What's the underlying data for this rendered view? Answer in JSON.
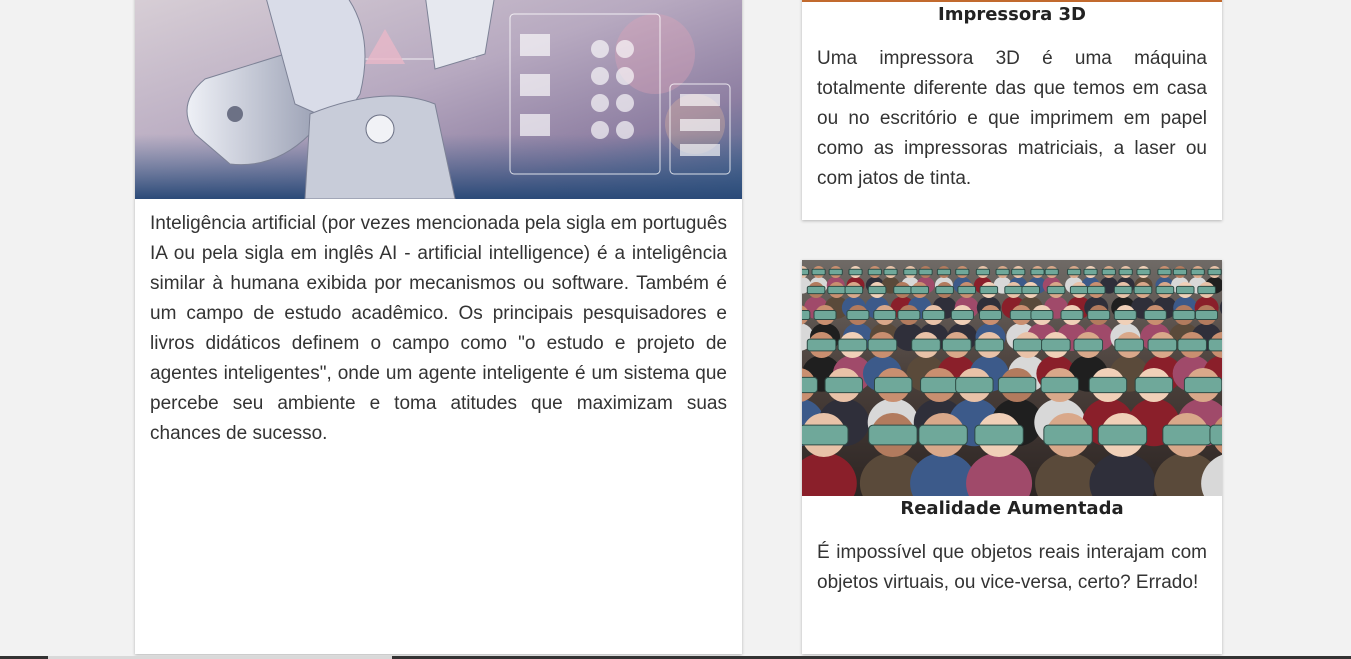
{
  "cards": {
    "ai": {
      "image_alt": "Robô com interface de inteligência artificial",
      "text": "Inteligência artificial (por vezes mencionada pela sigla em português IA ou pela sigla em inglês AI - artificial intelligence) é a inteligência similar à humana exibida por mecanismos ou software. Também é um campo de estudo acadêmico. Os principais pesquisadores e livros didáticos definem o campo como \"o estudo e projeto de agentes inteligentes\", onde um agente inteligente é um sistema que percebe seu ambiente e toma atitudes que maximizam suas chances de sucesso."
    },
    "printer3d": {
      "title": "Impressora 3D",
      "text": "Uma impressora 3D é uma máquina totalmente diferente das que temos em casa ou no escritório e que imprimem em papel como as impressoras matriciais, a laser ou com jatos de tinta."
    },
    "ar": {
      "image_alt": "Plateia usando óculos de realidade virtual",
      "title": "Realidade Aumentada",
      "text": "É impossível que objetos reais interajam com objetos virtuais, ou vice-versa, certo? Errado!"
    }
  },
  "colors": {
    "page_bg": "#f2f2f2",
    "card_bg": "#ffffff",
    "accent_line": "#c26a2e",
    "text": "#333333"
  }
}
